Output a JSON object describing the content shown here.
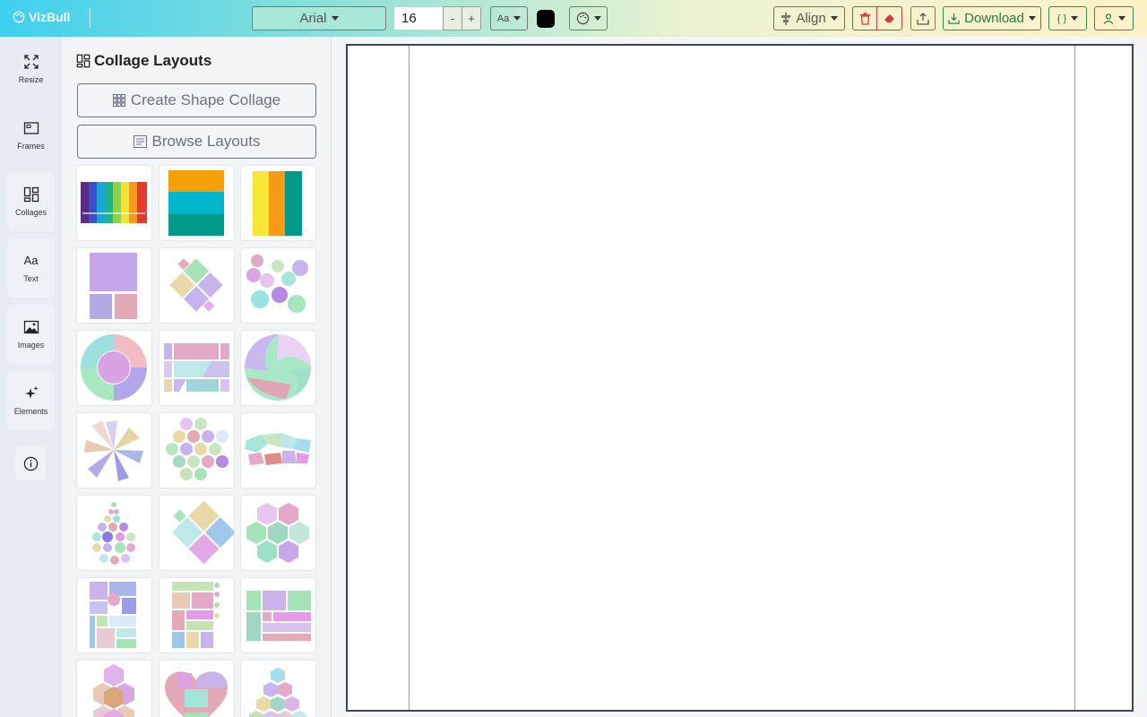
{
  "brand": {
    "name": "VizBull",
    "icon": "palette-icon"
  },
  "toolbar": {
    "font_family": "Arial",
    "font_size": "16",
    "minus": "-",
    "plus": "+",
    "text_case": "Aa",
    "text_color": "#000000",
    "align_label": "Align",
    "download_label": "Download",
    "code_label": "{ }"
  },
  "rail": {
    "items": [
      {
        "label": "Resize",
        "icon": "resize-icon"
      },
      {
        "label": "Frames",
        "icon": "frame-icon"
      },
      {
        "label": "Collages",
        "icon": "collage-icon"
      },
      {
        "label": "Text",
        "icon": "text-icon"
      },
      {
        "label": "Images",
        "icon": "image-icon"
      },
      {
        "label": "Elements",
        "icon": "sparkle-icon"
      }
    ],
    "info_icon": "info-icon"
  },
  "panel": {
    "title": "Collage Layouts",
    "create_label": "Create Shape Collage",
    "browse_label": "Browse Layouts",
    "thumbs": [
      "rainbow-stripes",
      "three-horizontal-bands",
      "three-vertical-bands",
      "square-grid",
      "diamond-mosaic",
      "flower-cluster",
      "donut-ring",
      "diagonal-split",
      "volleyball",
      "pinwheel",
      "hexagon-honeycomb",
      "polygon-mosaic",
      "droplet-circles",
      "rotated-squares",
      "hexagon-cluster",
      "block-mosaic",
      "tall-grid",
      "wide-grid",
      "hexagon-stack",
      "jigsaw-heart",
      "hexagon-pyramid"
    ]
  },
  "colors": {
    "brand_gradient_start": "#3ed0f0",
    "brand_gradient_end": "#fdf1c8",
    "download_green": "#2f8f52",
    "delete_red": "#d43b3b"
  }
}
